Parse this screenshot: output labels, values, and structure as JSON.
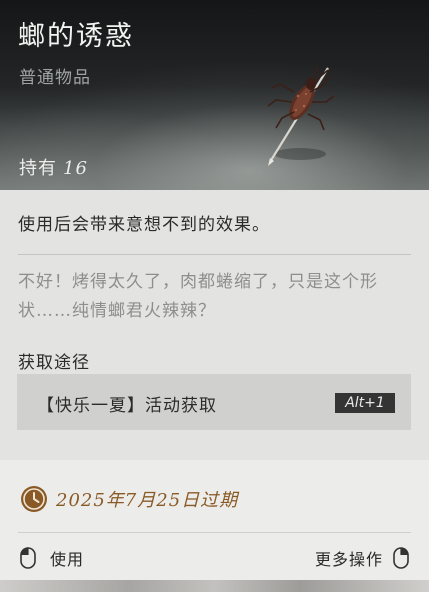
{
  "item": {
    "name": "螂的诱惑",
    "category": "普通物品",
    "owned_label": "持有",
    "owned_count": "16",
    "effect": "使用后会带来意想不到的效果。",
    "flavor": "不好！烤得太久了，肉都蜷缩了，只是这个形状……纯情螂君火辣辣？"
  },
  "source": {
    "label": "获取途径",
    "text": "【快乐一夏】活动获取",
    "hotkey": "Alt+1"
  },
  "expiry": {
    "text": "2025年7月25日过期",
    "color": "#8a5a26"
  },
  "actions": {
    "use_label": "使用",
    "more_label": "更多操作"
  },
  "icons": [
    "skewered-cockroach-icon",
    "clock-icon",
    "mouse-left-icon",
    "mouse-right-icon"
  ]
}
